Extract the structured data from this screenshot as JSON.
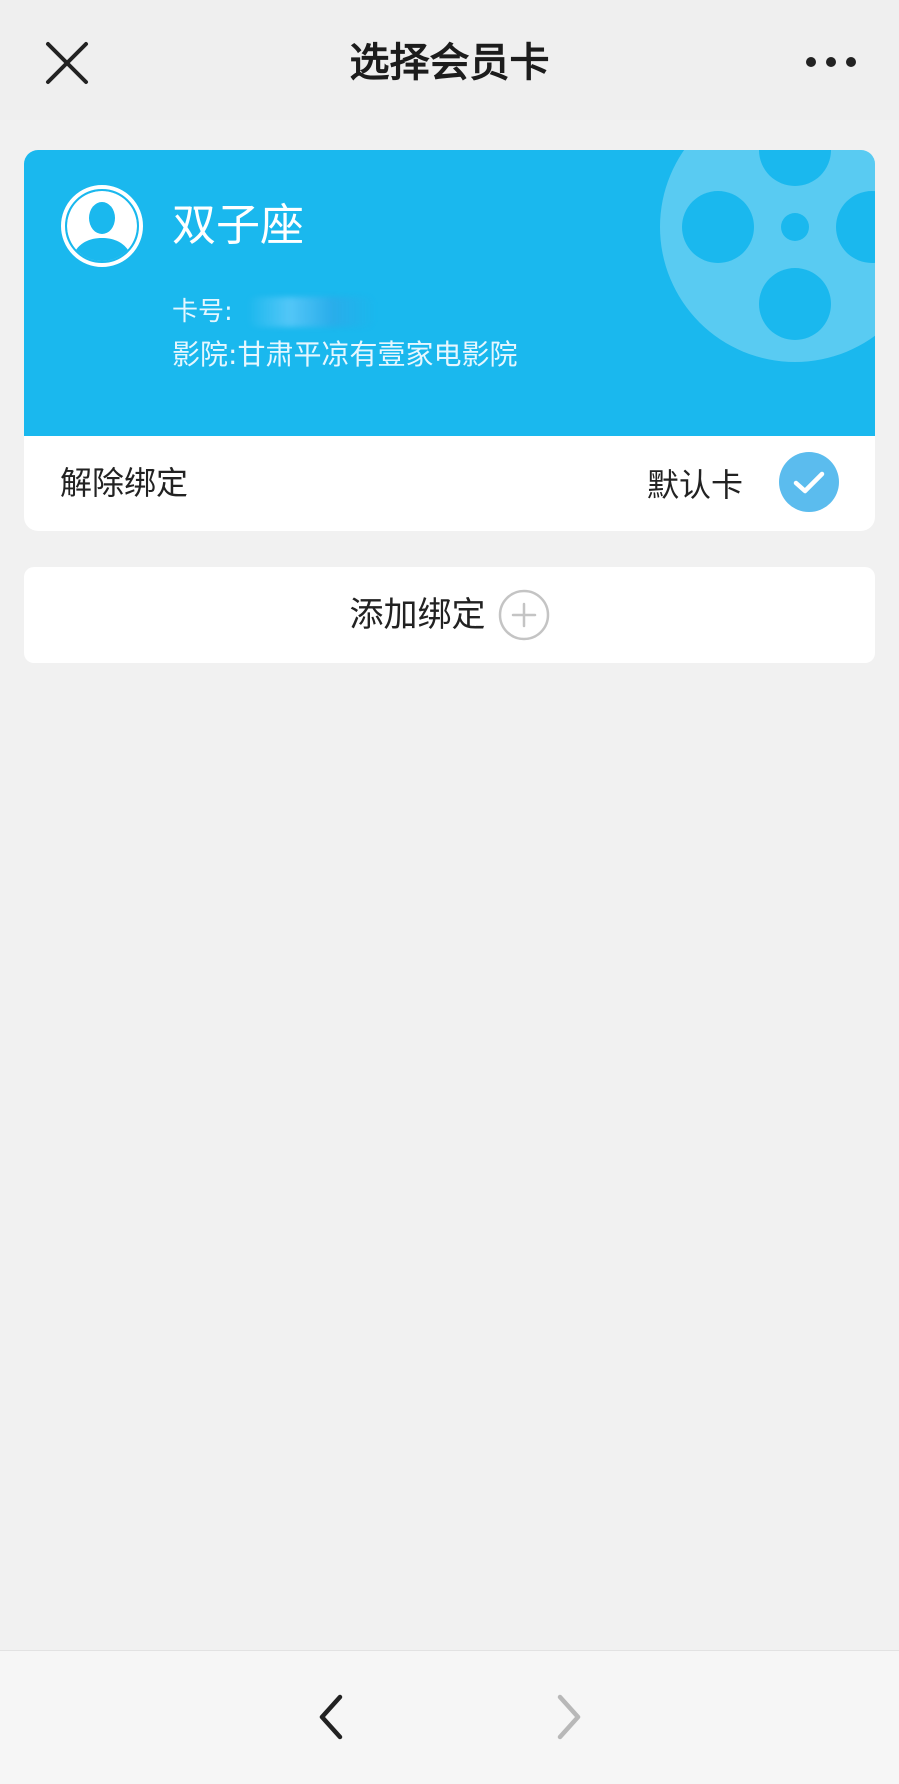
{
  "header": {
    "title": "选择会员卡",
    "close_icon": "close-icon",
    "more_icon": "more-icon"
  },
  "card": {
    "name": "双子座",
    "card_no_label": "卡号:",
    "cinema_label": "影院:",
    "cinema_name": "甘肃平凉有壹家电影院",
    "unbind_label": "解除绑定",
    "default_label": "默认卡",
    "accent_color": "#1ab8ee"
  },
  "add": {
    "label": "添加绑定"
  },
  "bottom_nav": {
    "back_icon": "chevron-left-icon",
    "forward_icon": "chevron-right-icon"
  }
}
